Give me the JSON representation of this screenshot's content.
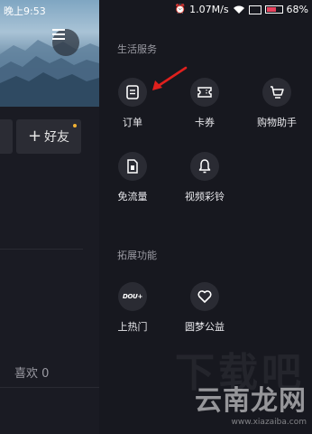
{
  "status_bar": {
    "time": "晚上9:53",
    "speed": "1.07M/s",
    "battery": "68%",
    "battery_level": 0.68
  },
  "profile": {
    "add_friend_label": "好友",
    "add_friend_icon": "plus-icon",
    "likes_label": "喜欢 0"
  },
  "drawer": {
    "section_life": {
      "title": "生活服务",
      "items": [
        {
          "label": "订单",
          "icon": "order-document-icon"
        },
        {
          "label": "卡券",
          "icon": "ticket-coupon-icon"
        },
        {
          "label": "购物助手",
          "icon": "shopping-cart-icon"
        },
        {
          "label": "免流量",
          "icon": "sim-card-icon"
        },
        {
          "label": "视频彩铃",
          "icon": "bell-icon"
        }
      ]
    },
    "section_ext": {
      "title": "拓展功能",
      "items": [
        {
          "label": "上热门",
          "icon": "dou-plus-icon",
          "icon_text": "DOU+"
        },
        {
          "label": "圆梦公益",
          "icon": "heart-charity-icon"
        }
      ]
    }
  },
  "watermark": {
    "text": "云南龙网",
    "url": "www.xiazaiba.com",
    "bg_text": "下载吧"
  },
  "colors": {
    "drawer_bg": "#17181f",
    "icon_circle": "#2a2b33",
    "arrow": "#e0201d",
    "battery": "#e8435e",
    "dot": "#f2b233"
  }
}
